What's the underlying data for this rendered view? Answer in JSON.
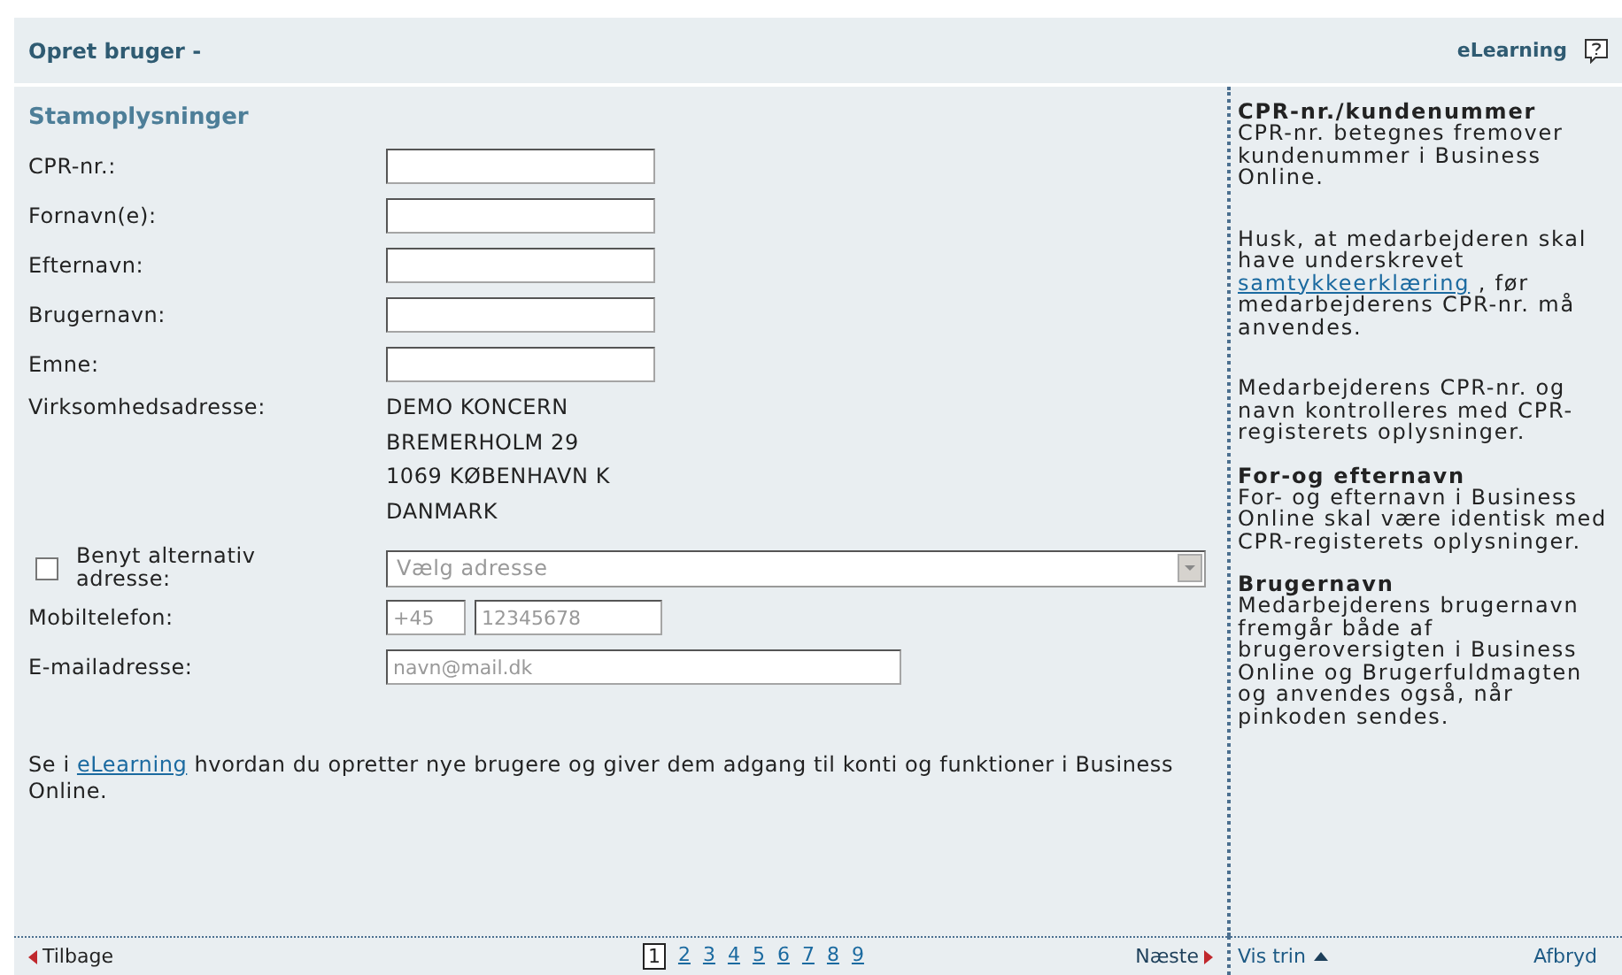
{
  "header": {
    "title": "Opret bruger -",
    "link": "eLearning"
  },
  "section_title": "Stamoplysninger",
  "rows": [
    {
      "kind": "input",
      "label": "CPR-nr.:"
    },
    {
      "kind": "input",
      "label": "Fornavn(e):"
    },
    {
      "kind": "input",
      "label": "Efternavn:"
    },
    {
      "kind": "input",
      "label": "Brugernavn:"
    },
    {
      "kind": "input",
      "label": "Emne:"
    },
    {
      "kind": "address",
      "label": "Virksomhedsadresse:",
      "lines": [
        "DEMO KONCERN",
        "BREMERHOLM 29",
        "1069 KØBENHAVN K",
        "DANMARK"
      ]
    },
    {
      "kind": "checkbox_select",
      "label": "Benyt alternativ adresse:",
      "checked": false,
      "value": "Vælg adresse",
      "disabled": true
    },
    {
      "kind": "phone",
      "label": "Mobiltelefon:",
      "prefix_placeholder": "+45",
      "placeholder": "12345678"
    },
    {
      "kind": "email",
      "label": "E-mailadresse:",
      "placeholder": "navn@mail.dk"
    }
  ],
  "note": [
    {
      "text": "Se i ",
      "link": false
    },
    {
      "text": "eLearning",
      "link": true
    },
    {
      "text": " hvordan du opretter nye brugere og giver dem adgang til konti og funktioner i Business Online.",
      "link": false
    }
  ],
  "sidebar": [
    {
      "title": "CPR-nr./kundenummer",
      "paragraphs": [
        [
          {
            "text": "CPR-nr. betegnes fremover kundenummer i Business Online.",
            "link": false
          }
        ],
        [
          {
            "text": "Husk, at medarbejderen skal have underskrevet ",
            "link": false
          },
          {
            "text": "samtykkeerklæring",
            "link": true
          },
          {
            "text": " , før medarbejderens CPR-nr. må anvendes.",
            "link": false
          }
        ],
        [
          {
            "text": "Medarbejderens CPR-nr. og navn kontrolleres med CPR-registerets oplysninger.",
            "link": false
          }
        ]
      ]
    },
    {
      "title": "For-og efternavn",
      "paragraphs": [
        [
          {
            "text": "For- og efternavn i Business Online skal være identisk med CPR-registerets oplysninger.",
            "link": false
          }
        ]
      ]
    },
    {
      "title": "Brugernavn",
      "paragraphs": [
        [
          {
            "text": "Medarbejderens brugernavn fremgår både af brugeroversigten i Business Online og Brugerfuldmagten og anvendes også, når pinkoden sendes.",
            "link": false
          }
        ]
      ]
    }
  ],
  "footer": {
    "back": "Tilbage",
    "pages": [
      {
        "label": "1",
        "selected": true
      },
      {
        "label": "2",
        "selected": false
      },
      {
        "label": "3",
        "selected": false
      },
      {
        "label": "4",
        "selected": false
      },
      {
        "label": "5",
        "selected": false
      },
      {
        "label": "6",
        "selected": false
      },
      {
        "label": "7",
        "selected": false
      },
      {
        "label": "8",
        "selected": false
      },
      {
        "label": "9",
        "selected": false
      }
    ],
    "next": "Næste",
    "show_steps": "Vis trin",
    "cancel": "Afbryd"
  }
}
